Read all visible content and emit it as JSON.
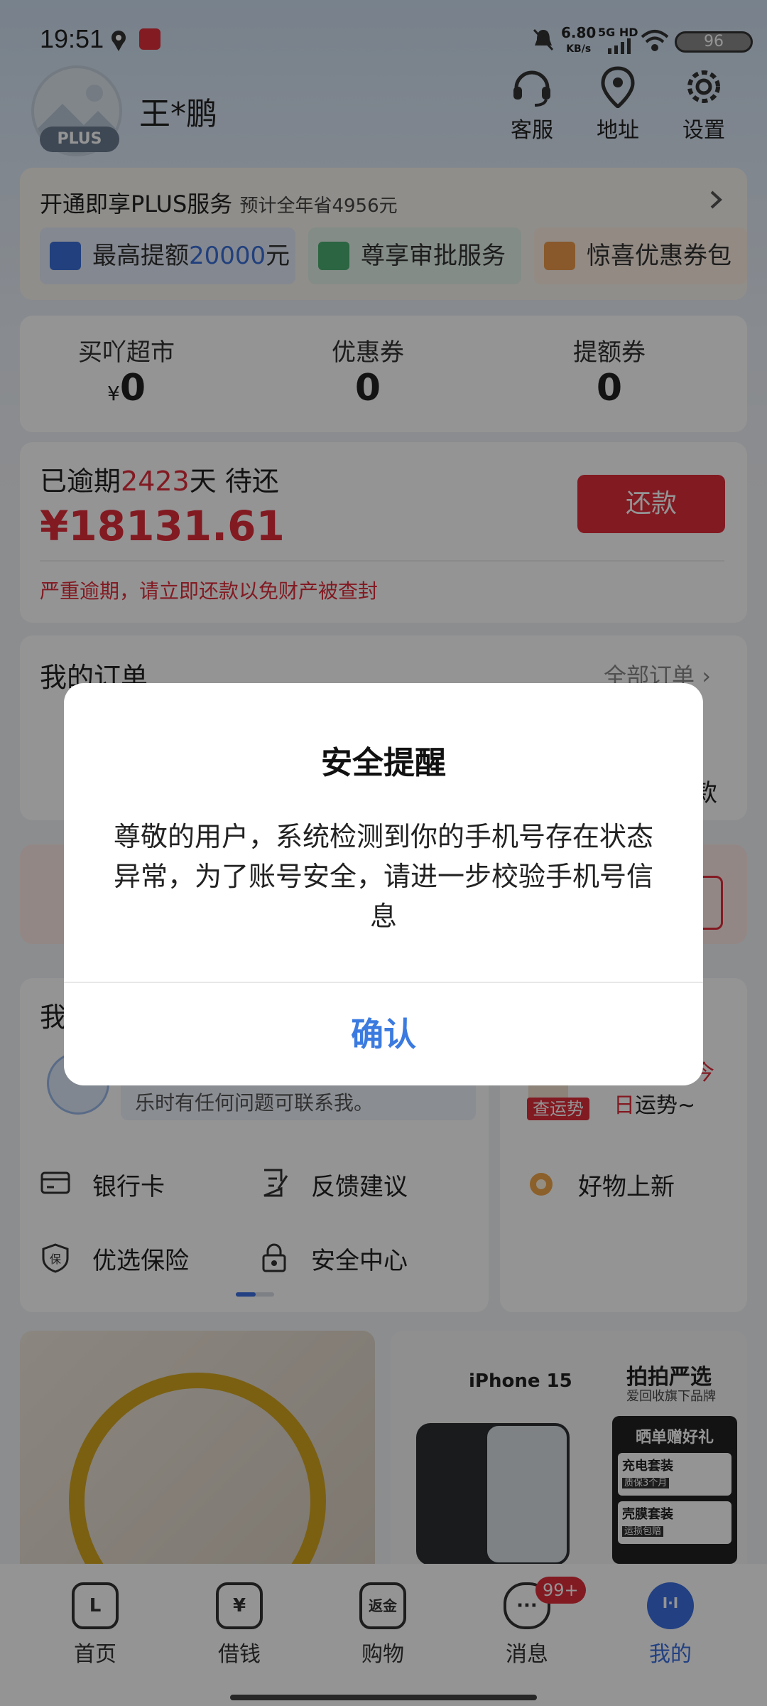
{
  "status_bar": {
    "time": "19:51",
    "net_speed": "6.80",
    "net_unit": "KB/s",
    "network": "5G HD",
    "battery": "96"
  },
  "header": {
    "avatar_badge": "PLUS",
    "username": "王*鹏",
    "actions": [
      {
        "label": "客服",
        "icon": "headset-icon"
      },
      {
        "label": "地址",
        "icon": "location-pin-icon"
      },
      {
        "label": "设置",
        "icon": "gear-icon"
      }
    ]
  },
  "plus_card": {
    "title": "开通即享PLUS服务",
    "subtitle": "预计全年省4956元",
    "chips": [
      {
        "prefix": "最高提额",
        "highlight": "20000",
        "suffix": "元"
      },
      {
        "prefix": "尊享审批服务",
        "highlight": "",
        "suffix": ""
      },
      {
        "prefix": "惊喜优惠券包",
        "highlight": "",
        "suffix": ""
      }
    ]
  },
  "stats": [
    {
      "label": "买吖超市",
      "currency": "¥",
      "value": "0"
    },
    {
      "label": "优惠券",
      "currency": "",
      "value": "0"
    },
    {
      "label": "提额券",
      "currency": "",
      "value": "0"
    }
  ],
  "repay_card": {
    "overdue_prefix": "已逾期",
    "overdue_days": "2423",
    "overdue_suffix": "天 待还",
    "amount": "¥18131.61",
    "button": "还款",
    "warning": "严重逾期，请立即还款以免财产被查封"
  },
  "orders": {
    "title": "我的订单",
    "all_link": "全部订单",
    "partial_right": "款"
  },
  "services": {
    "title_partial": "我",
    "notice_partial": "乐时有任何问题可联系我。",
    "fortune_tag": "查运势",
    "fortune_text_red": "日",
    "fortune_text": "运势~",
    "fortune_top": "今",
    "items": [
      {
        "label": "银行卡",
        "icon": "bank-card-icon"
      },
      {
        "label": "反馈建议",
        "icon": "feedback-icon"
      },
      {
        "label": "优选保险",
        "icon": "insurance-shield-icon"
      },
      {
        "label": "安全中心",
        "icon": "lock-icon"
      }
    ],
    "new_goods": "好物上新"
  },
  "promo": {
    "phone_model": "iPhone 15",
    "brand": "拍拍严选",
    "brand_sub": "爱回收旗下品牌",
    "gift": "晒单赠好礼",
    "charger": "充电套装",
    "charger_sub": "质保3个月",
    "case": "壳膜套装",
    "case_sub": "运损包赔"
  },
  "bottom_nav": [
    {
      "label": "首页",
      "glyph": "L"
    },
    {
      "label": "借钱",
      "glyph": "¥"
    },
    {
      "label": "购物",
      "glyph": "返金"
    },
    {
      "label": "消息",
      "glyph": "···",
      "badge": "99+"
    },
    {
      "label": "我的",
      "glyph": "I·I",
      "active": true
    }
  ],
  "dialog": {
    "title": "安全提醒",
    "message": "尊敬的用户，系统检测到你的手机号存在状态异常，为了账号安全，请进一步校验手机号信息",
    "confirm": "确认"
  },
  "colors": {
    "accent_red": "#e02d3c",
    "link_blue": "#3b7be0",
    "active_nav": "#3b6fe0"
  }
}
